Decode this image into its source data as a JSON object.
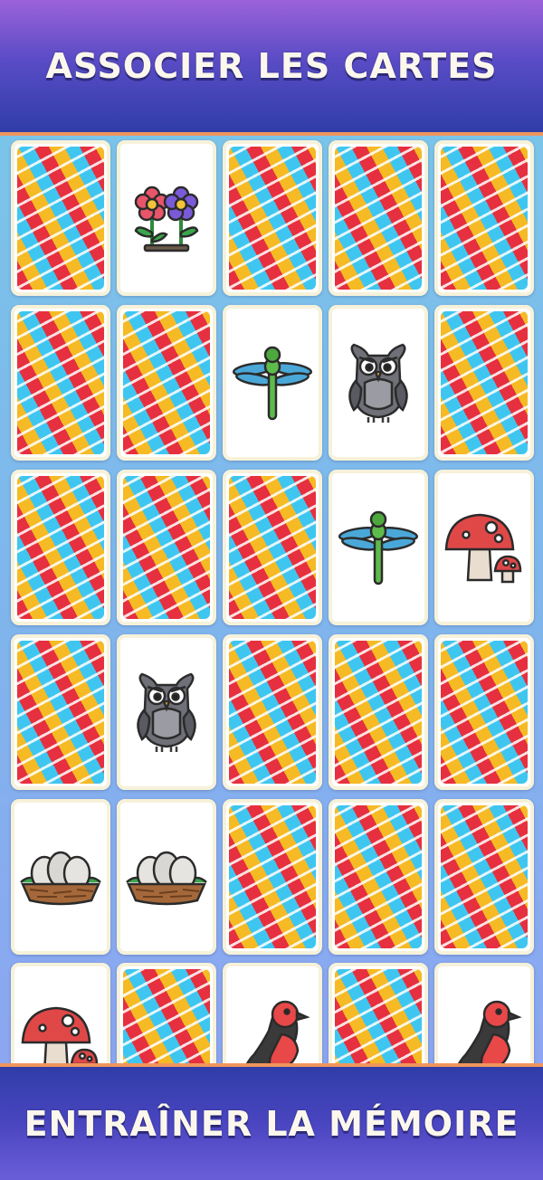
{
  "header": {
    "title": "ASSOCIER LES CARTES"
  },
  "footer": {
    "title": "ENTRAÎNER LA MÉMOIRE"
  },
  "colors": {
    "header_top": "#9b62d9",
    "header_bottom": "#2f3da8",
    "accent_line": "#f0955c",
    "card_border": "#f6f2da",
    "card_red": "#e6303f",
    "card_yellow": "#f5ba24",
    "card_blue": "#3ec6f0"
  },
  "board": {
    "columns": 5,
    "cards": [
      "back",
      "flowers",
      "back",
      "back",
      "back",
      "back",
      "back",
      "dragonfly",
      "owl",
      "back",
      "back",
      "back",
      "back",
      "dragonfly",
      "mushroom",
      "back",
      "owl",
      "back",
      "back",
      "back",
      "eggs-nest",
      "eggs-nest",
      "back",
      "back",
      "back",
      "mushroom",
      "back",
      "bird",
      "back",
      "bird"
    ]
  }
}
